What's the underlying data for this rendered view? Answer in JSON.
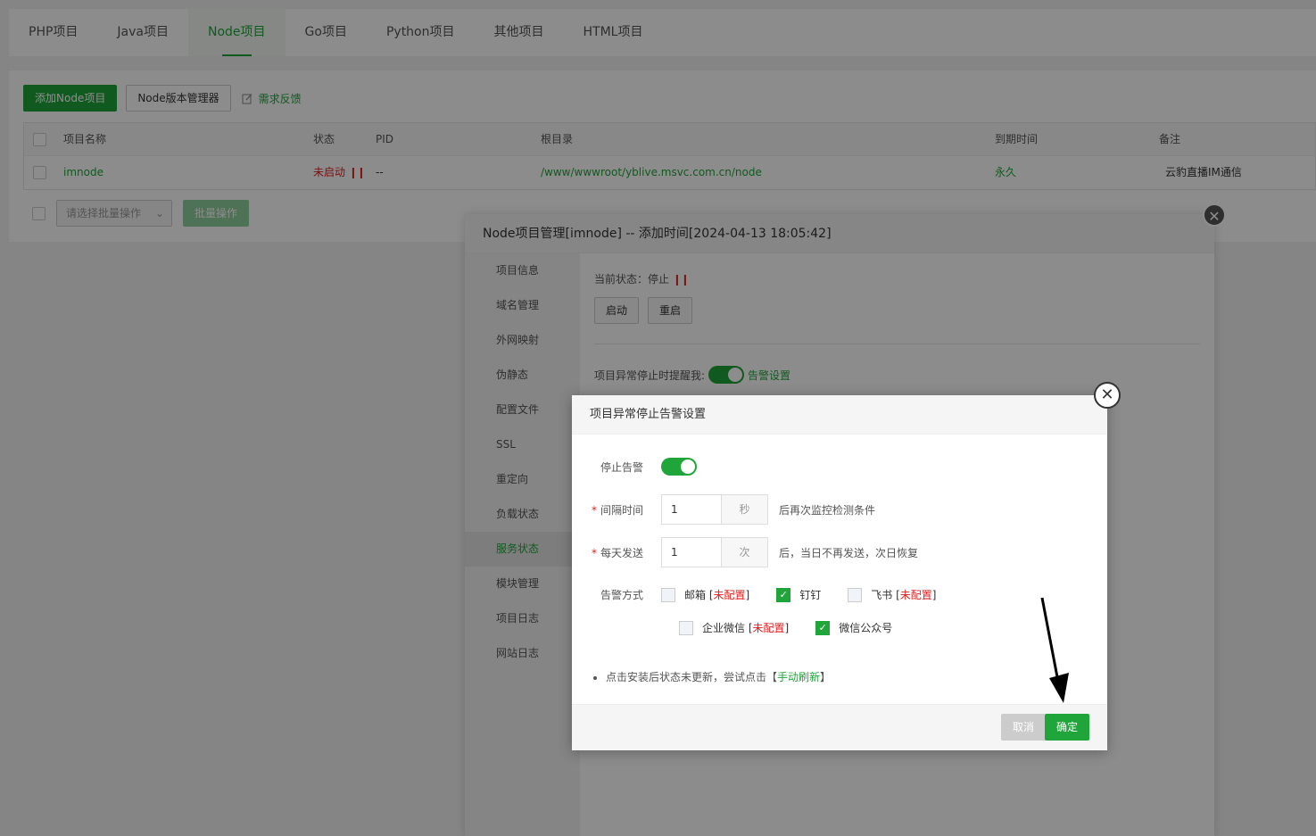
{
  "tabs": [
    "PHP项目",
    "Java项目",
    "Node项目",
    "Go项目",
    "Python项目",
    "其他项目",
    "HTML项目"
  ],
  "active_tab": "Node项目",
  "toolbar": {
    "add_label": "添加Node项目",
    "version_manager_label": "Node版本管理器",
    "feedback_label": "需求反馈"
  },
  "table": {
    "headers": {
      "name": "项目名称",
      "status": "状态",
      "pid": "PID",
      "root": "根目录",
      "expire": "到期时间",
      "note": "备注"
    },
    "rows": [
      {
        "name": "imnode",
        "status": "未启动",
        "pid": "--",
        "root": "/www/wwwroot/yblive.msvc.com.cn/node",
        "expire": "永久",
        "note": "云豹直播IM通信"
      }
    ]
  },
  "batch": {
    "select_placeholder": "请选择批量操作",
    "button_label": "批量操作"
  },
  "panel": {
    "title": "Node项目管理[imnode] -- 添加时间[2024-04-13 18:05:42]",
    "side_items": [
      "项目信息",
      "域名管理",
      "外网映射",
      "伪静态",
      "配置文件",
      "SSL",
      "重定向",
      "负载状态",
      "服务状态",
      "模块管理",
      "项目日志",
      "网站日志"
    ],
    "active_side": "服务状态",
    "status_label": "当前状态：停止",
    "start_label": "启动",
    "restart_label": "重启",
    "alarm_label": "项目异常停止时提醒我:",
    "alarm_settings_label": "告警设置"
  },
  "modal": {
    "title": "项目异常停止告警设置",
    "stop_alarm_label": "停止告警",
    "interval_label": "间隔时间",
    "interval_value": "1",
    "interval_unit": "秒",
    "interval_after": "后再次监控检测条件",
    "daily_label": "每天发送",
    "daily_value": "1",
    "daily_unit": "次",
    "daily_after": "后，当日不再发送，次日恢复",
    "method_label": "告警方式",
    "methods": [
      {
        "name": "邮箱",
        "note": "未配置",
        "checked": false
      },
      {
        "name": "钉钉",
        "note": "",
        "checked": true
      },
      {
        "name": "飞书",
        "note": "未配置",
        "checked": false
      },
      {
        "name": "企业微信",
        "note": "未配置",
        "checked": false
      },
      {
        "name": "微信公众号",
        "note": "",
        "checked": true
      }
    ],
    "tip_prefix": "点击安装后状态未更新，尝试点击【",
    "tip_link": "手动刷新",
    "tip_suffix": "】",
    "cancel_label": "取消",
    "ok_label": "确定"
  },
  "colors": {
    "accent": "#20a53a",
    "danger": "#e02020"
  }
}
